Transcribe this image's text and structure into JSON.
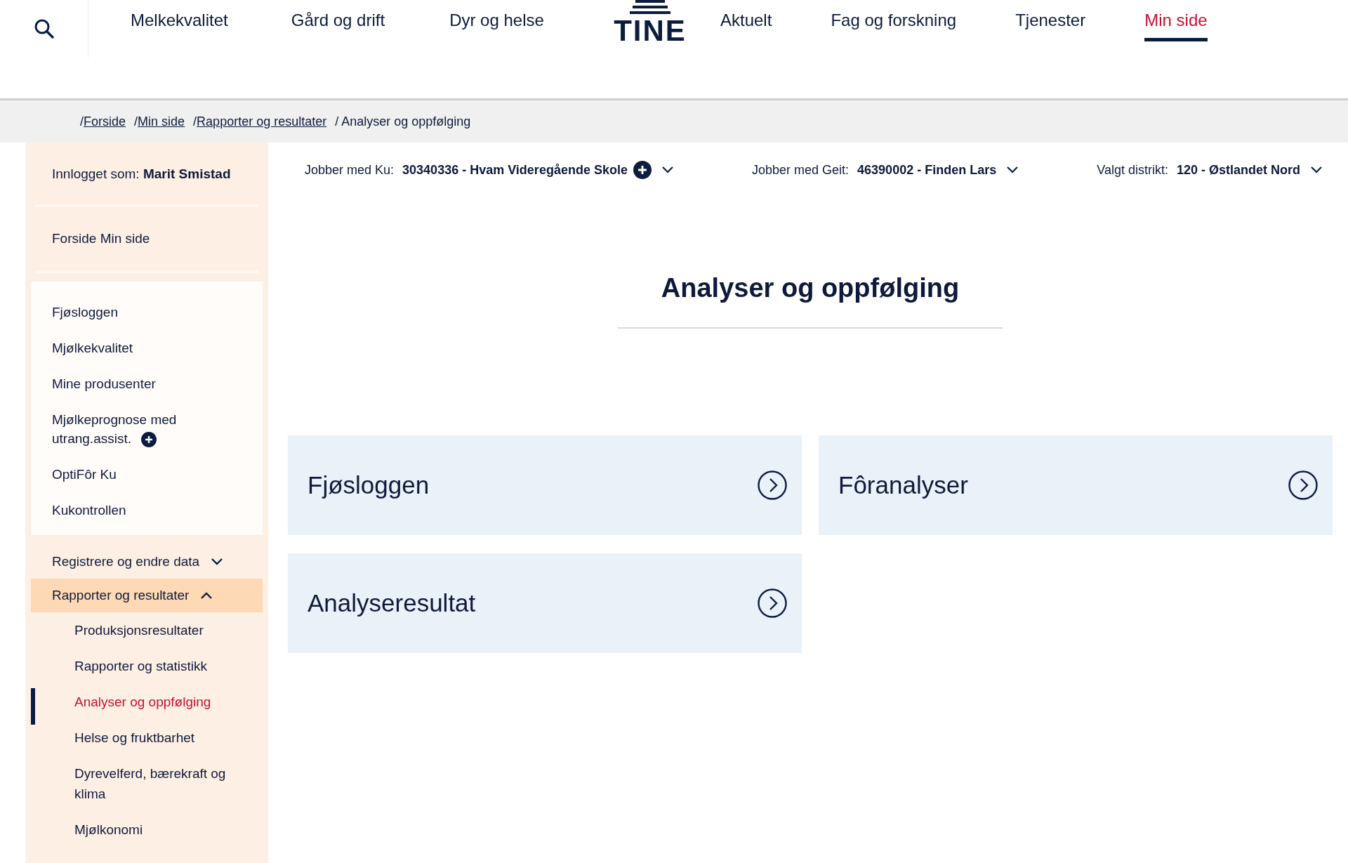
{
  "nav": {
    "items": [
      {
        "label": "Melkekvalitet",
        "selected": false
      },
      {
        "label": "Gård og drift",
        "selected": false
      },
      {
        "label": "Dyr og helse",
        "selected": false
      },
      {
        "label": "Aktuelt",
        "selected": false
      },
      {
        "label": "Fag og forskning",
        "selected": false
      },
      {
        "label": "Tjenester",
        "selected": false
      },
      {
        "label": "Min side",
        "selected": true
      }
    ],
    "logo": "TINE"
  },
  "breadcrumb": [
    {
      "sep": "/",
      "label": "Forside",
      "kind": "link"
    },
    {
      "sep": "/",
      "label": "Min side",
      "kind": "link"
    },
    {
      "sep": "/",
      "label": "Rapporter og resultater",
      "kind": "link"
    },
    {
      "sep": "/",
      "label": "Analyser og oppfølging",
      "kind": "current"
    }
  ],
  "sidebar": {
    "user": "Innlogget som: **Marit Smistad**",
    "home": "Forside Min side",
    "items": [
      {
        "label": "Fjøsloggen",
        "plus": false
      },
      {
        "label": "Mjølkekvalitet",
        "plus": false
      },
      {
        "label": "Mine produsenter",
        "plus": false
      },
      {
        "label": "Mjølkeprognose med utrang.assist.",
        "plus": true
      },
      {
        "label": "OptiFôr Ku",
        "plus": false
      },
      {
        "label": "Kukontrollen",
        "plus": false
      }
    ],
    "sections": [
      {
        "label": "Registrere og endre data",
        "expanded": false,
        "selected": false
      },
      {
        "label": "Rapporter og resultater",
        "expanded": true,
        "selected": true,
        "children": [
          {
            "label": "Produksjonsresultater",
            "selected": false
          },
          {
            "label": "Rapporter og statistikk",
            "selected": false
          },
          {
            "label": "Analyser og oppfølging",
            "selected": true
          },
          {
            "label": "Helse og fruktbarhet",
            "selected": false
          },
          {
            "label": "Dyrevelferd, bærekraft og klima",
            "selected": false
          },
          {
            "label": "Mjølkonomi",
            "selected": false
          }
        ]
      }
    ]
  },
  "selectors": [
    {
      "label": "Jobber med Ku:",
      "value": "30340336 - Hvam Videregående Skole",
      "plus": true
    },
    {
      "label": "Jobber med Geit:",
      "value": "46390002 - Finden Lars",
      "plus": false
    },
    {
      "label": "Valgt distrikt:",
      "value": "120 - Østlandet Nord",
      "plus": false
    }
  ],
  "title": "Analyser og oppfølging",
  "cards": [
    {
      "title": "Fjøsloggen"
    },
    {
      "title": "Fôranalyser"
    },
    {
      "title": "Analyseresultat"
    }
  ]
}
